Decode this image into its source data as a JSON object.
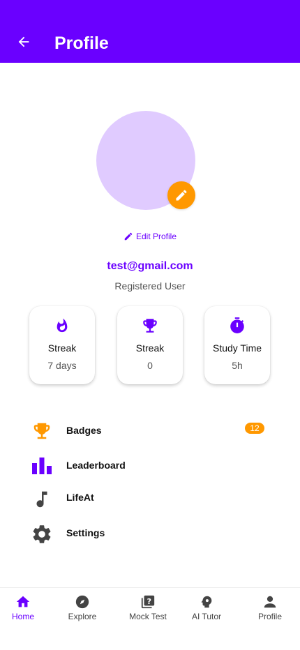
{
  "colors": {
    "primary": "#6a00ff",
    "accent": "#ff9800",
    "avatar_bg": "#e0cbff"
  },
  "header": {
    "title": "Profile",
    "back_icon": "arrow-left-icon"
  },
  "profile": {
    "edit_profile_label": "Edit Profile",
    "email": "test@gmail.com",
    "role": "Registered User"
  },
  "stats": [
    {
      "icon": "flame-icon",
      "label": "Streak",
      "value": "7 days"
    },
    {
      "icon": "trophy-icon",
      "label": "Streak",
      "value": "0"
    },
    {
      "icon": "timer-icon",
      "label": "Study Time",
      "value": "5h"
    }
  ],
  "menu": [
    {
      "icon": "trophy-icon",
      "label": "Badges",
      "badge": "12"
    },
    {
      "icon": "bar-chart-icon",
      "label": "Leaderboard"
    },
    {
      "icon": "music-note-icon",
      "label": "LifeAt"
    },
    {
      "icon": "gear-icon",
      "label": "Settings"
    }
  ],
  "bottom_nav": [
    {
      "icon": "home-icon",
      "label": "Home",
      "active": true
    },
    {
      "icon": "compass-icon",
      "label": "Explore"
    },
    {
      "icon": "quiz-icon",
      "label": "Mock Test"
    },
    {
      "icon": "brain-head-icon",
      "label": "AI Tutor"
    },
    {
      "icon": "person-icon",
      "label": "Profile"
    }
  ]
}
